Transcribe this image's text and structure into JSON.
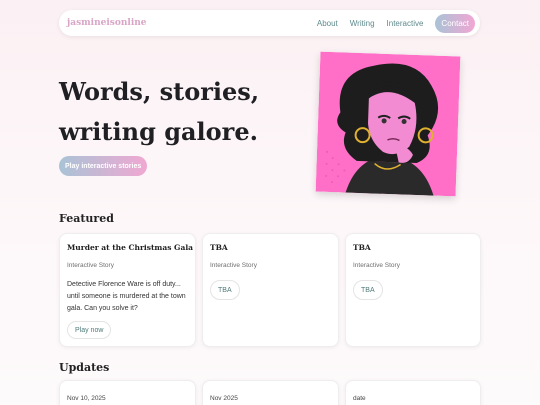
{
  "nav": {
    "logo": "jasmineisonline",
    "links": [
      "About",
      "Writing",
      "Interactive"
    ],
    "contact": "Contact"
  },
  "hero": {
    "title_line1": "Words, stories,",
    "title_line2": "writing galore.",
    "cta": "Play interactive stories"
  },
  "featured": {
    "heading": "Featured",
    "cards": [
      {
        "title": "Murder at the Christmas Gala",
        "type": "Interactive Story",
        "description": "Detective Florence Ware is off duty... until someone is murdered at the town gala. Can you solve it?",
        "button": "Play now"
      },
      {
        "title": "TBA",
        "type": "Interactive Story",
        "button": "TBA"
      },
      {
        "title": "TBA",
        "type": "Interactive Story",
        "button": "TBA"
      }
    ]
  },
  "updates": {
    "heading": "Updates",
    "cards": [
      {
        "date": "Nov 10, 2025"
      },
      {
        "date": "Nov 2025"
      },
      {
        "date": "date"
      }
    ]
  },
  "colors": {
    "accent_pink": "#f2a6d4",
    "accent_blue": "#a9c3d6",
    "portrait_bg": "#ff6fc8"
  }
}
